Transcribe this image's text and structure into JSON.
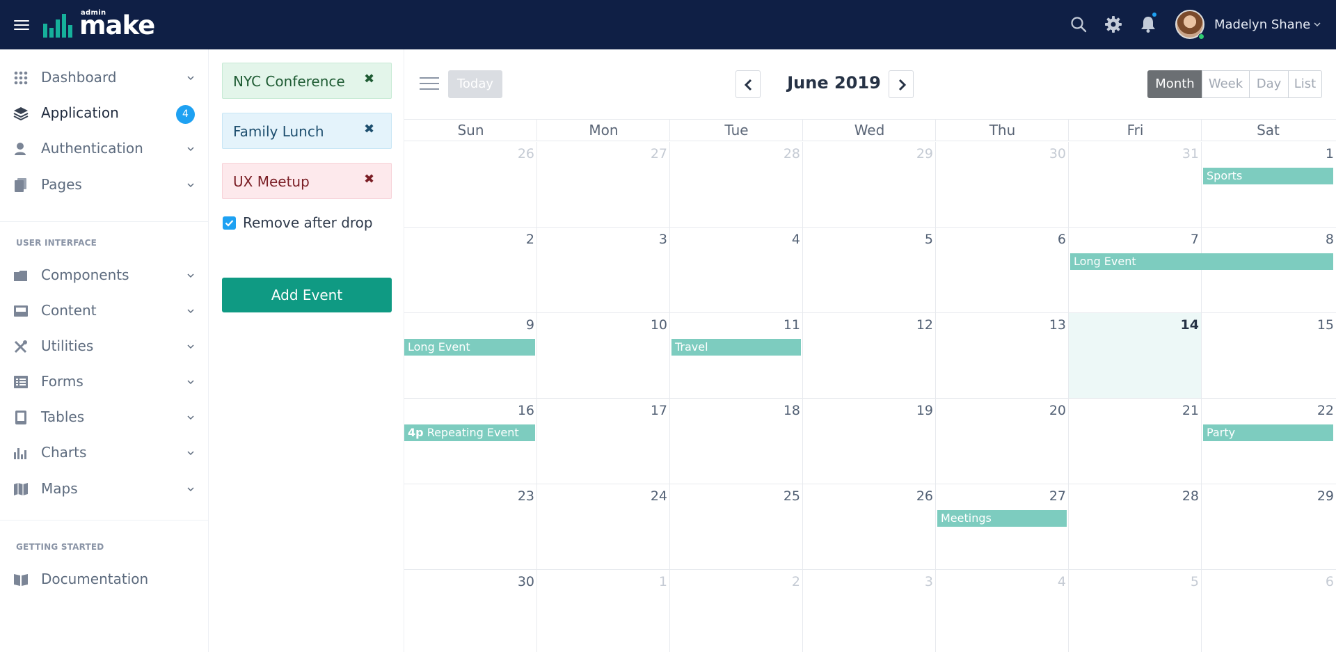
{
  "brand": {
    "small": "admin",
    "big": "make"
  },
  "user": {
    "name": "Madelyn Shane"
  },
  "sidebar": {
    "items": [
      {
        "label": "Dashboard",
        "icon": "grid-icon"
      },
      {
        "label": "Application",
        "icon": "layers-icon",
        "badge": "4"
      },
      {
        "label": "Authentication",
        "icon": "user-icon"
      },
      {
        "label": "Pages",
        "icon": "pages-icon"
      }
    ],
    "ui_section": "USER INTERFACE",
    "ui_items": [
      {
        "label": "Components",
        "icon": "folder-icon"
      },
      {
        "label": "Content",
        "icon": "inbox-icon"
      },
      {
        "label": "Utilities",
        "icon": "tools-icon"
      },
      {
        "label": "Forms",
        "icon": "list-icon"
      },
      {
        "label": "Tables",
        "icon": "tablet-icon"
      },
      {
        "label": "Charts",
        "icon": "bar-chart-icon"
      },
      {
        "label": "Maps",
        "icon": "map-icon"
      }
    ],
    "start_section": "GETTING STARTED",
    "doc_item": {
      "label": "Documentation",
      "icon": "book-icon"
    }
  },
  "external_events": [
    {
      "label": "NYC Conference",
      "close": "✖",
      "color": "#e3f5ea"
    },
    {
      "label": "Family Lunch",
      "close": "✖",
      "color": "#e4f3fb"
    },
    {
      "label": "UX Meetup",
      "close": "✖",
      "color": "#fde9ec"
    }
  ],
  "remove_after_drop": {
    "label": "Remove after drop",
    "checked": true
  },
  "add_event_label": "Add Event",
  "calendar": {
    "today_label": "Today",
    "title": "June 2019",
    "views": [
      "Month",
      "Week",
      "Day",
      "List"
    ],
    "active_view": "Month",
    "days_of_week": [
      "Sun",
      "Mon",
      "Tue",
      "Wed",
      "Thu",
      "Fri",
      "Sat"
    ],
    "weeks": [
      [
        "26",
        "27",
        "28",
        "29",
        "30",
        "31",
        "1"
      ],
      [
        "2",
        "3",
        "4",
        "5",
        "6",
        "7",
        "8"
      ],
      [
        "9",
        "10",
        "11",
        "12",
        "13",
        "14",
        "15"
      ],
      [
        "16",
        "17",
        "18",
        "19",
        "20",
        "21",
        "22"
      ],
      [
        "23",
        "24",
        "25",
        "26",
        "27",
        "28",
        "29"
      ],
      [
        "30",
        "1",
        "2",
        "3",
        "4",
        "5",
        "6"
      ]
    ],
    "today": "14",
    "event_color": "#7dccbf",
    "events": [
      {
        "title": "Sports",
        "date": "2019-06-01"
      },
      {
        "title": "Long Event",
        "start": "2019-06-07",
        "end": "2019-06-09"
      },
      {
        "title": "Travel",
        "date": "2019-06-11"
      },
      {
        "title": "Repeating Event",
        "time": "4p",
        "date": "2019-06-16"
      },
      {
        "title": "Party",
        "date": "2019-06-22"
      },
      {
        "title": "Meetings",
        "date": "2019-06-27"
      }
    ]
  }
}
